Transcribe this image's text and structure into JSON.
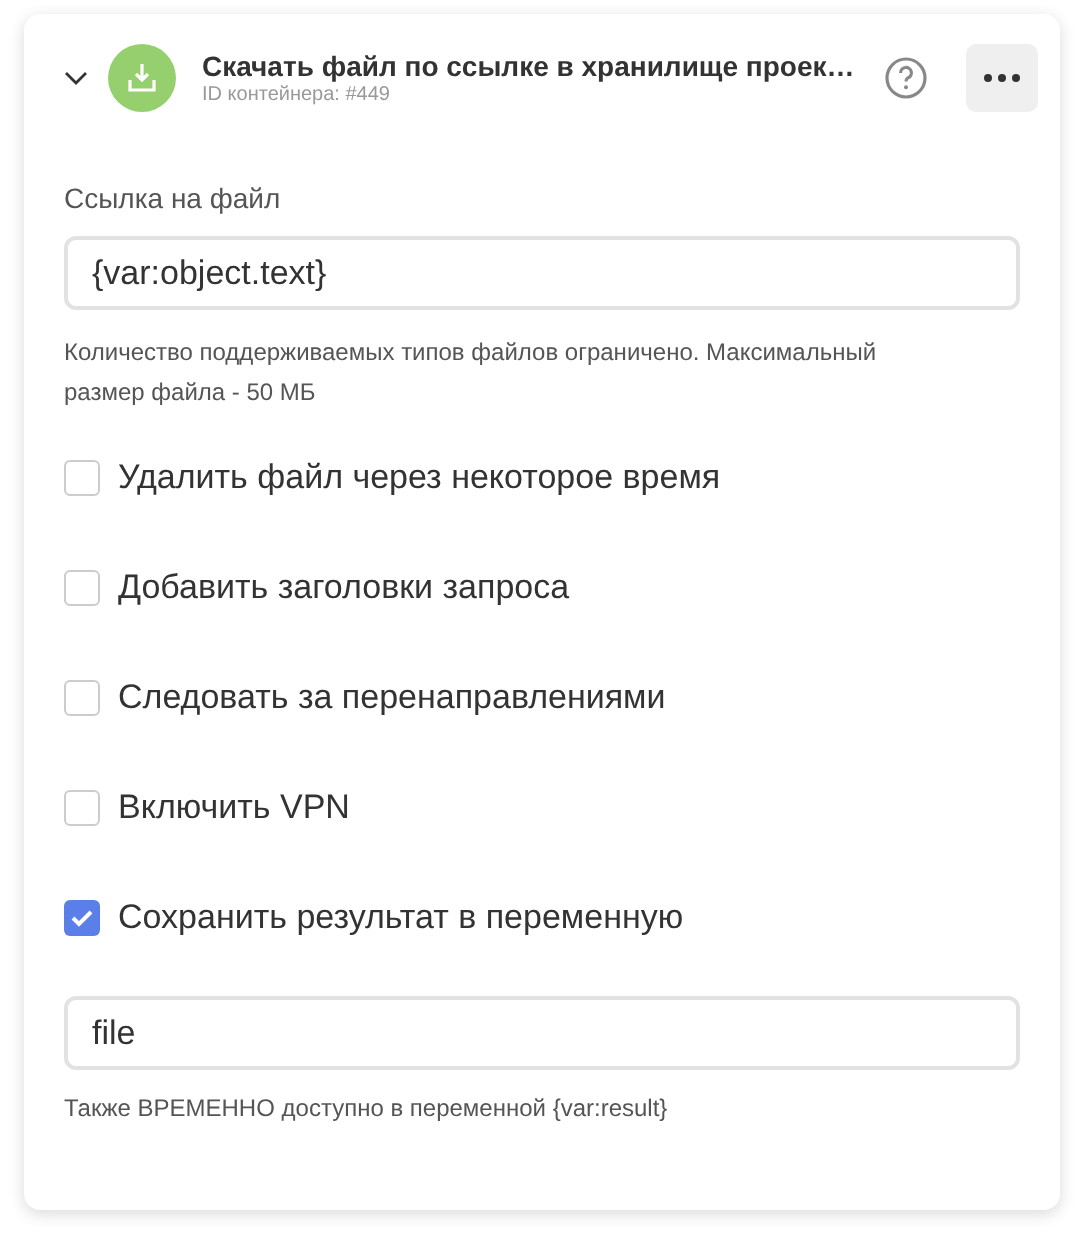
{
  "header": {
    "title": "Скачать файл по ссылке в хранилище проек…",
    "subtitle": "ID контейнера: #449",
    "expanded": true
  },
  "url_field": {
    "label": "Ссылка на файл",
    "value": "{var:object.text}",
    "hint": "Количество поддерживаемых типов файлов ограничено. Максимальный размер файла - 50 МБ"
  },
  "options": [
    {
      "label": "Удалить файл через некоторое время",
      "checked": false
    },
    {
      "label": "Добавить заголовки запроса",
      "checked": false
    },
    {
      "label": "Следовать за перенаправлениями",
      "checked": false
    },
    {
      "label": "Включить VPN",
      "checked": false
    },
    {
      "label": "Сохранить результат в переменную",
      "checked": true
    }
  ],
  "result_field": {
    "value": "file",
    "hint": "Также ВРЕМЕННО доступно в переменной {var:result}"
  }
}
